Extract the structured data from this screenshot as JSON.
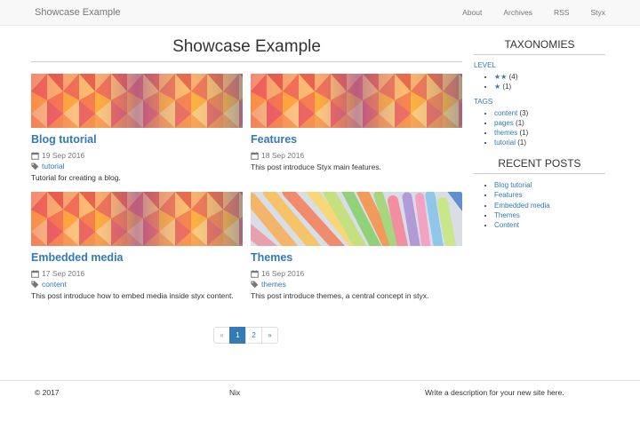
{
  "navbar": {
    "brand": "Showcase Example",
    "links": [
      "About",
      "Archives",
      "RSS",
      "Styx"
    ]
  },
  "main": {
    "title": "Showcase Example",
    "posts": [
      {
        "title": "Blog tutorial",
        "date": "19 Sep 2016",
        "tag": "tutorial",
        "description": "Tutorial for creating a blog."
      },
      {
        "title": "Features",
        "date": "18 Sep 2016",
        "tag": "",
        "description": "This post introduce Styx main features."
      },
      {
        "title": "Embedded media",
        "date": "17 Sep 2016",
        "tag": "content",
        "description": "This post introduce how to embed media inside styx content."
      },
      {
        "title": "Themes",
        "date": "16 Sep 2016",
        "tag": "themes",
        "description": "This post introduce themes, a central concept in styx."
      }
    ]
  },
  "pagination": {
    "prev": "«",
    "pages": [
      "1",
      "2"
    ],
    "next": "»",
    "current": "1"
  },
  "sidebar": {
    "taxonomies_title": "TAXONOMIES",
    "level_label": "LEVEL",
    "levels": [
      {
        "name": "★★",
        "count": "(4)"
      },
      {
        "name": "★",
        "count": "(1)"
      }
    ],
    "tags_label": "TAGS",
    "tags": [
      {
        "name": "content",
        "count": "(3)"
      },
      {
        "name": "pages",
        "count": "(1)"
      },
      {
        "name": "themes",
        "count": "(1)"
      },
      {
        "name": "tutorial",
        "count": "(1)"
      }
    ],
    "recent_title": "RECENT POSTS",
    "recent": [
      "Blog tutorial",
      "Features",
      "Embedded media",
      "Themes",
      "Content"
    ]
  },
  "footer": {
    "copyright": "© 2017",
    "center_link": "Nix",
    "description": "Write a description for your new site here."
  },
  "colors": {
    "link": "#337ab7",
    "navbar_bg": "#f8f8f8",
    "active_page": "#337ab7"
  }
}
